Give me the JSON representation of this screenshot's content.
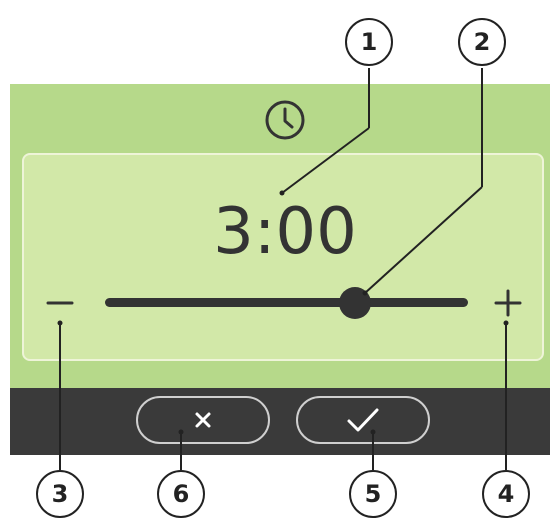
{
  "colors": {
    "screen_bg": "#b6d98a",
    "panel_bg": "#d2e8a8",
    "panel_border": "#eef4d8",
    "bottom_bar_bg": "#3a3a3a",
    "text_dark": "#333333",
    "pill_border": "#cfcfcf",
    "icon_light": "#ffffff",
    "callout_border": "#222222"
  },
  "header": {
    "icon": "clock-icon"
  },
  "timer": {
    "value": "3:00"
  },
  "slider": {
    "level_fraction": 0.69
  },
  "controls": {
    "decrease_icon": "minus-icon",
    "increase_icon": "plus-icon",
    "cancel_icon": "close-icon",
    "confirm_icon": "checkmark-icon"
  },
  "callouts": [
    "1",
    "2",
    "3",
    "4",
    "5",
    "6"
  ]
}
